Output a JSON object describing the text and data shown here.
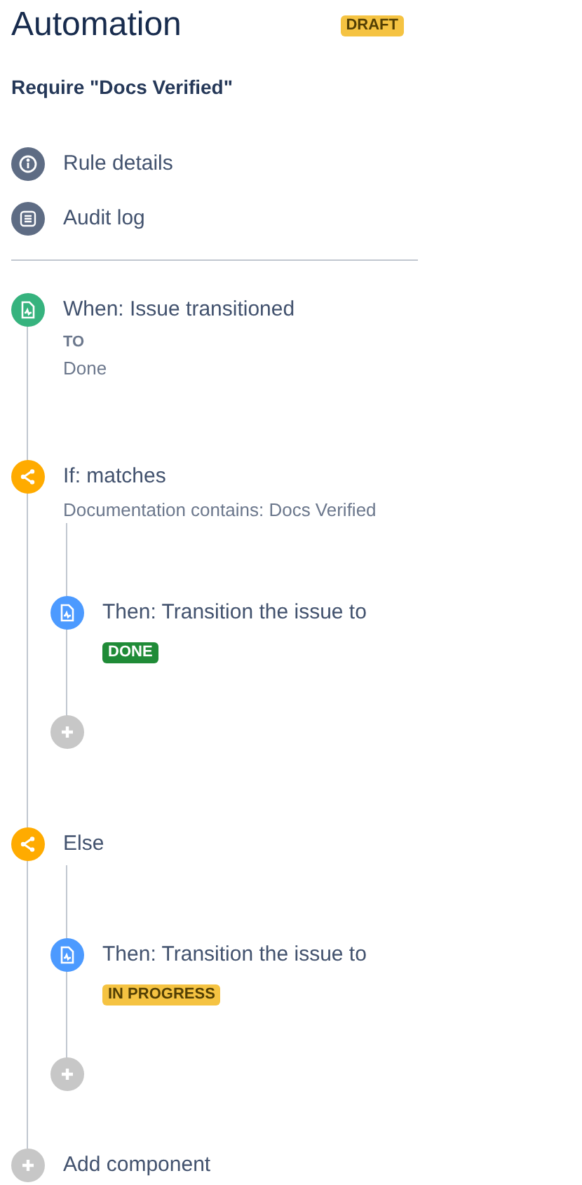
{
  "header": {
    "title": "Automation",
    "status": {
      "text": "DRAFT",
      "color": "#f5c342"
    }
  },
  "rule_name": "Require \"Docs Verified\"",
  "menu": [
    {
      "label": "Rule details",
      "kind": "info"
    },
    {
      "label": "Audit log",
      "kind": "log"
    }
  ],
  "flow": [
    {
      "kind": "trigger",
      "title": "When: Issue transitioned",
      "detail_label": "TO",
      "detail": "Done"
    },
    {
      "kind": "condition",
      "title": "If: matches",
      "detail": "Documentation contains: Docs Verified",
      "children": [
        {
          "kind": "action",
          "title": "Then: Transition the issue to",
          "badge": {
            "text": "DONE",
            "color": "#1f8b37"
          }
        },
        {
          "kind": "add"
        }
      ]
    },
    {
      "kind": "else",
      "title": "Else",
      "children": [
        {
          "kind": "action",
          "title": "Then: Transition the issue to",
          "badge": {
            "text": "IN PROGRESS",
            "color": "#f5c342"
          }
        },
        {
          "kind": "add"
        }
      ]
    },
    {
      "kind": "add",
      "title": "Add component"
    }
  ]
}
